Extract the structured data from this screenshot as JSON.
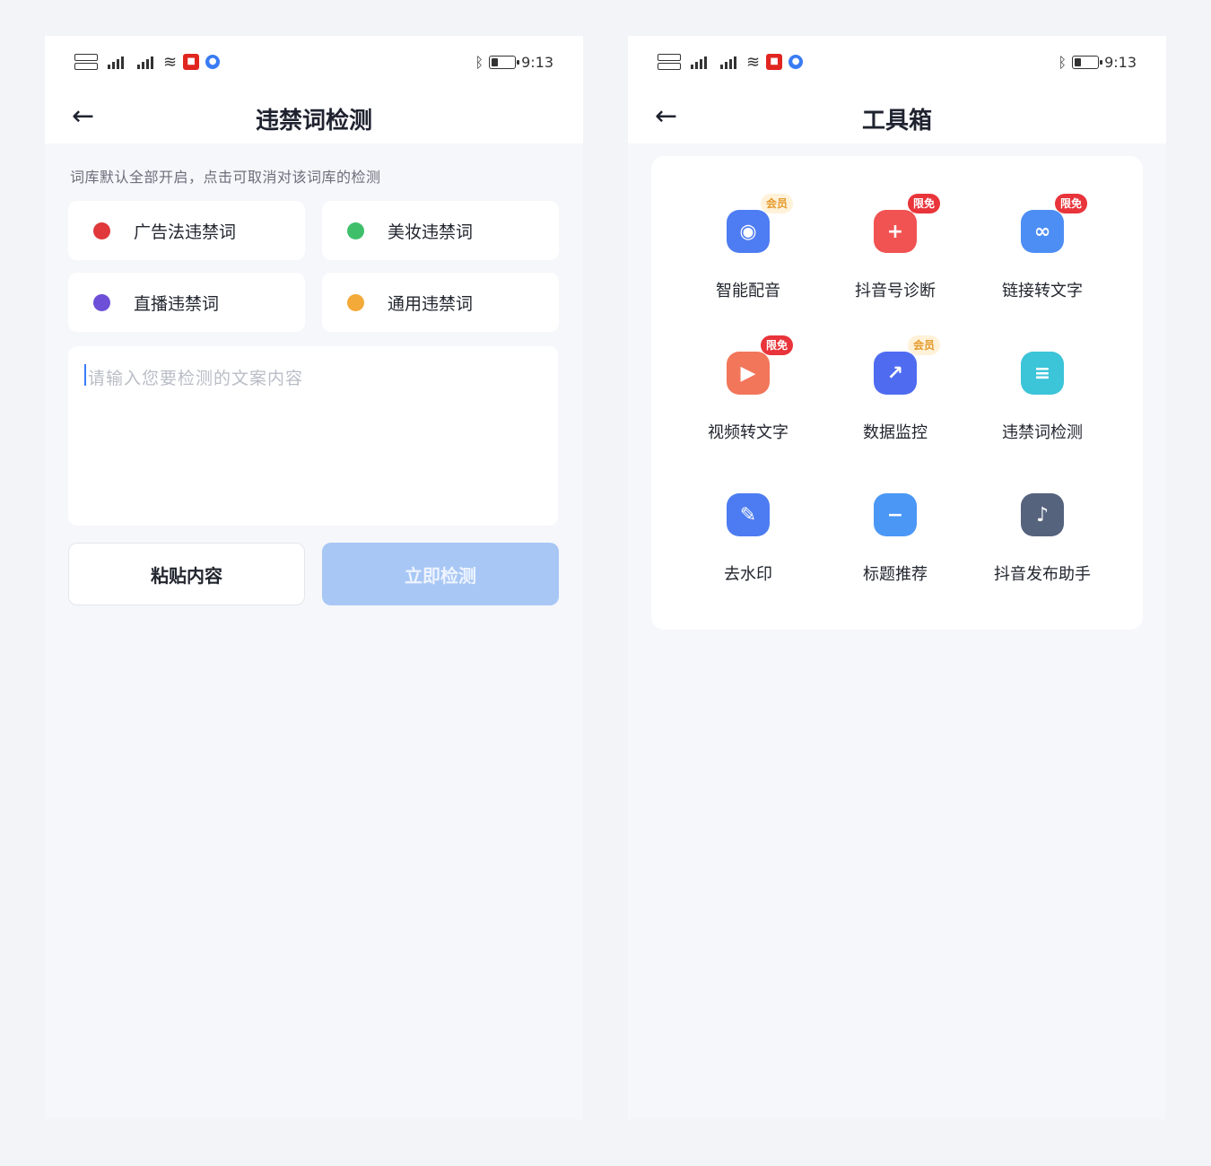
{
  "status_bar": {
    "time": "9:13"
  },
  "left_page": {
    "title": "违禁词检测",
    "hint": "词库默认全部开启，点击可取消对该词库的检测",
    "libraries": [
      {
        "label": "广告法违禁词",
        "color": "#e0383b"
      },
      {
        "label": "美妆违禁词",
        "color": "#3fbf6a"
      },
      {
        "label": "直播违禁词",
        "color": "#6d4fd8"
      },
      {
        "label": "通用违禁词",
        "color": "#f3aa38"
      }
    ],
    "input_placeholder": "请输入您要检测的文案内容",
    "paste_button": "粘贴内容",
    "detect_button": "立即检测"
  },
  "right_page": {
    "title": "工具箱",
    "tools": [
      {
        "label": "智能配音",
        "badge": "会员",
        "badge_type": "vip",
        "icon": "speech-bubble-icon",
        "color": "#4e7cf2"
      },
      {
        "label": "抖音号诊断",
        "badge": "限免",
        "badge_type": "free",
        "icon": "medical-plus-icon",
        "color": "#f05352"
      },
      {
        "label": "链接转文字",
        "badge": "限免",
        "badge_type": "free",
        "icon": "link-icon",
        "color": "#4d8ef5"
      },
      {
        "label": "视频转文字",
        "badge": "限免",
        "badge_type": "free",
        "icon": "play-icon",
        "color": "#f2765a"
      },
      {
        "label": "数据监控",
        "badge": "会员",
        "badge_type": "vip",
        "icon": "trend-chart-icon",
        "color": "#4f6cf0"
      },
      {
        "label": "违禁词检测",
        "badge": "",
        "badge_type": "",
        "icon": "document-icon",
        "color": "#3cc4d8"
      },
      {
        "label": "去水印",
        "badge": "",
        "badge_type": "",
        "icon": "eraser-icon",
        "color": "#4d7cf2"
      },
      {
        "label": "标题推荐",
        "badge": "",
        "badge_type": "",
        "icon": "title-bubble-icon",
        "color": "#4b97f5"
      },
      {
        "label": "抖音发布助手",
        "badge": "",
        "badge_type": "",
        "icon": "tiktok-icon",
        "color": "#55637d"
      }
    ]
  }
}
